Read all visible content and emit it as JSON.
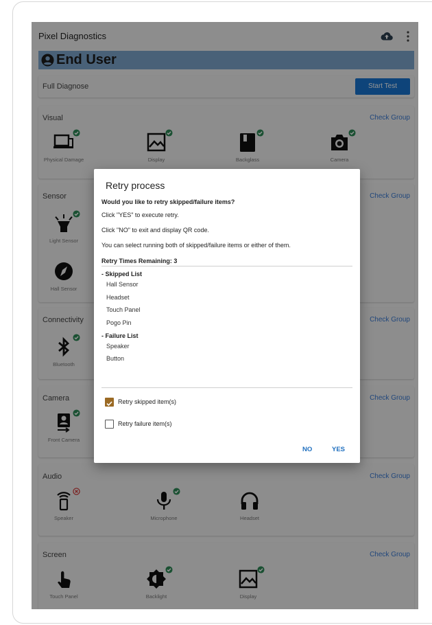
{
  "app": {
    "title": "Pixel Diagnostics",
    "user": "End User"
  },
  "full": {
    "label": "Full Diagnose",
    "button": "Start Test"
  },
  "groups": {
    "visual": {
      "title": "Visual",
      "check": "Check Group",
      "items": [
        "Physical Damage",
        "Display",
        "Backglass",
        "Camera"
      ]
    },
    "sensor": {
      "title": "Sensor",
      "check": "Check Group",
      "items": [
        "Light Sensor",
        "Hall Sensor"
      ]
    },
    "connectivity": {
      "title": "Connectivity",
      "check": "Check Group",
      "items": [
        "Bluetooth"
      ]
    },
    "camera": {
      "title": "Camera",
      "check": "Check Group",
      "items": [
        "Front Camera"
      ]
    },
    "audio": {
      "title": "Audio",
      "check": "Check Group",
      "items": [
        "Speaker",
        "Microphone",
        "Headset"
      ]
    },
    "screen": {
      "title": "Screen",
      "check": "Check Group",
      "items": [
        "Touch Panel",
        "Backlight",
        "Display"
      ]
    }
  },
  "dialog": {
    "title": "Retry process",
    "question": "Would you like to retry skipped/failure items?",
    "yes_hint": "Click \"YES\" to execute retry.",
    "no_hint": "Click \"NO\" to exit and display QR code.",
    "select_hint": "You can select running both of skipped/failure items or either of them.",
    "remaining": "Retry Times Remaining: 3",
    "skipped_title": "- Skipped List",
    "skipped": [
      "Hall Sensor",
      "Headset",
      "Touch Panel",
      "Pogo Pin"
    ],
    "failure_title": "- Failure List",
    "failure": [
      "Speaker",
      "Button"
    ],
    "retry_skipped": "Retry skipped item(s)",
    "retry_skipped_checked": true,
    "retry_failure": "Retry failure item(s)",
    "retry_failure_checked": false,
    "no": "NO",
    "yes": "YES"
  },
  "colors": {
    "accent": "#1976d2",
    "user_bar": "#7fa7cf",
    "pass": "#2e8b57",
    "fail": "#d32f2f",
    "checkbox": "#9b6a24"
  }
}
